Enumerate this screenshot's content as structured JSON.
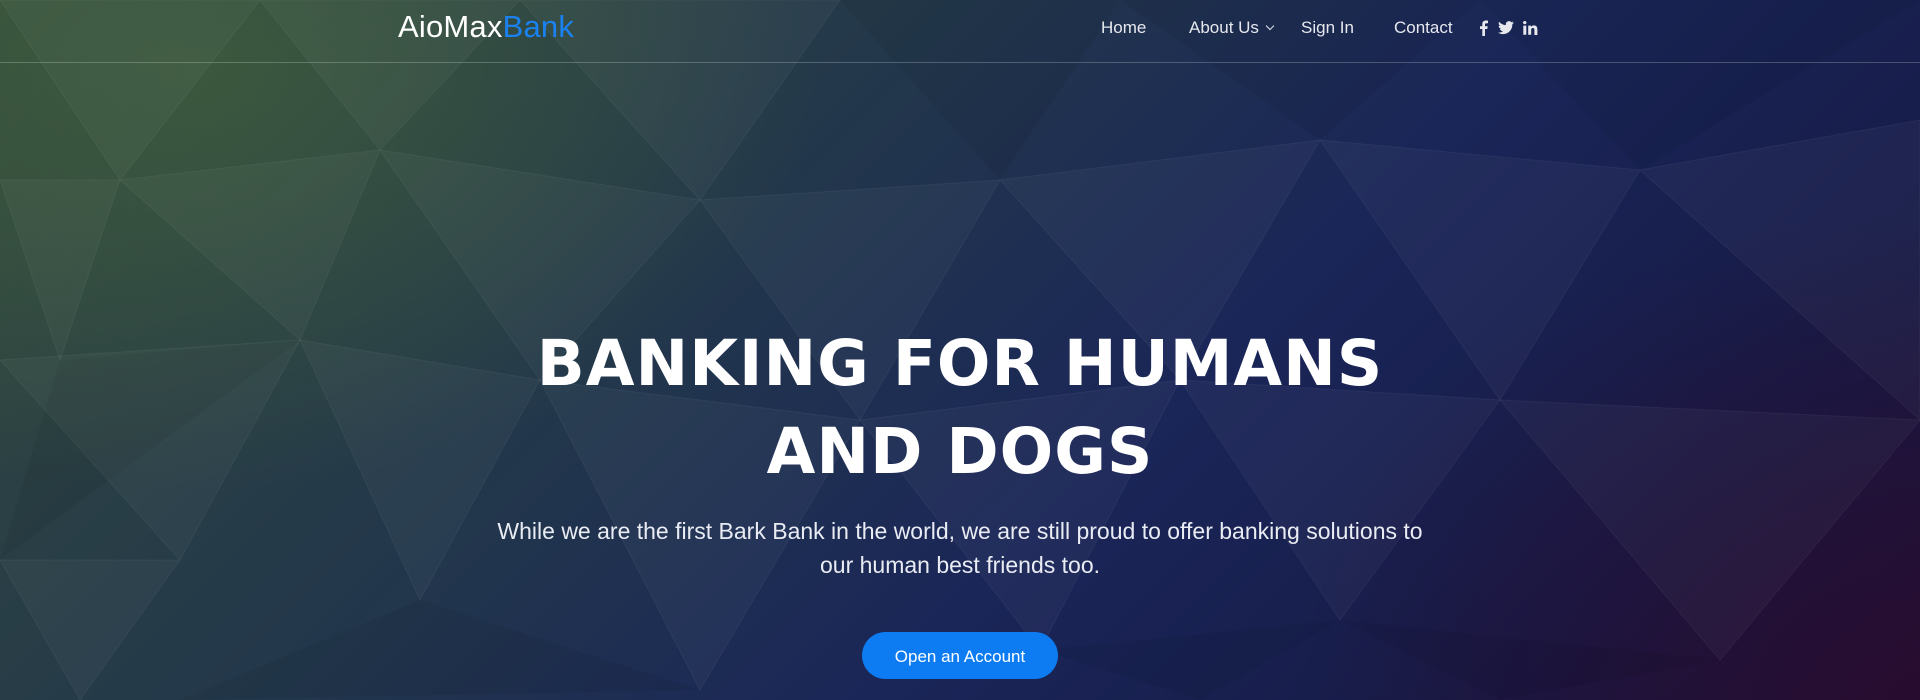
{
  "brand": {
    "name_part1": "AioMax",
    "name_part2": "Bank",
    "accent_color": "#1a82f0"
  },
  "nav": {
    "items": [
      {
        "label": "Home"
      },
      {
        "label": "About Us",
        "has_dropdown": true
      },
      {
        "label": "Sign In"
      },
      {
        "label": "Contact"
      }
    ],
    "social_icons": [
      "facebook-icon",
      "twitter-icon",
      "linkedin-icon"
    ]
  },
  "hero": {
    "title_line1": "BANKING FOR HUMANS",
    "title_line2": "AND DOGS",
    "subtitle_line1": "While we are the first Bark Bank in the world, we are still proud to offer banking solutions to",
    "subtitle_line2": "our human best friends too.",
    "cta_label": "Open an Account",
    "cta_color": "#0d7cf2"
  }
}
